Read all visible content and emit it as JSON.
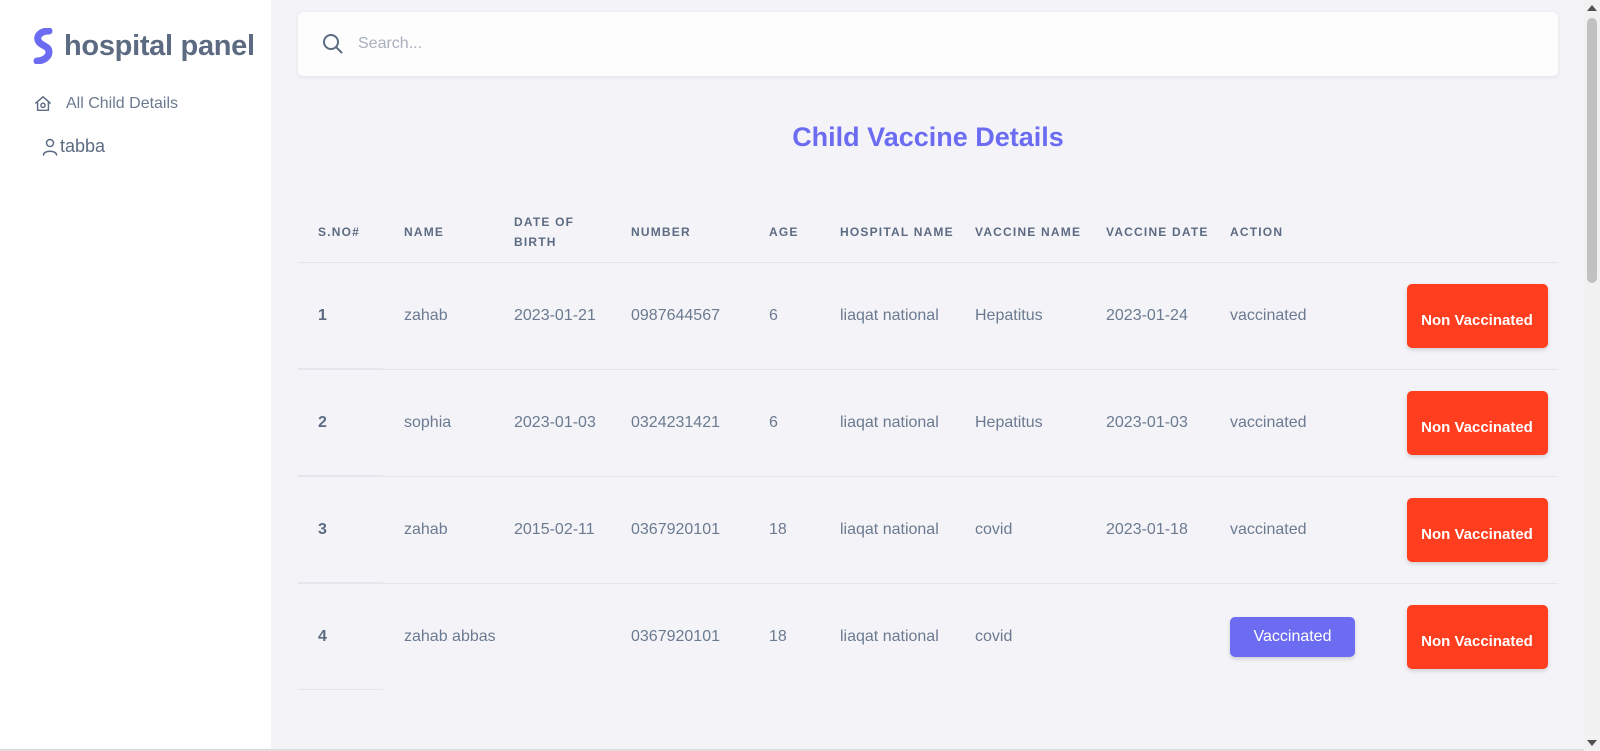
{
  "brand": {
    "name": "hospital panel"
  },
  "sidebar": {
    "items": [
      {
        "label": "All Child Details",
        "icon": "home-icon"
      },
      {
        "label": "tabba",
        "icon": "user-icon"
      }
    ]
  },
  "search": {
    "placeholder": "Search...",
    "value": ""
  },
  "page": {
    "title": "Child Vaccine Details"
  },
  "table": {
    "headers": [
      "S.NO#",
      "NAME",
      "DATE OF BIRTH",
      "NUMBER",
      "AGE",
      "HOSPITAL NAME",
      "VACCINE NAME",
      "VACCINE DATE",
      "ACTION",
      ""
    ],
    "rows": [
      {
        "sno": "1",
        "name": "zahab",
        "dob": "2023-01-21",
        "number": "0987644567",
        "age": "6",
        "hospital": "liaqat national",
        "vaccine": "Hepatitus",
        "vdate": "2023-01-24",
        "action": "vaccinated",
        "action_is_button": false,
        "non_label": "Non Vaccinated"
      },
      {
        "sno": "2",
        "name": "sophia",
        "dob": "2023-01-03",
        "number": "0324231421",
        "age": "6",
        "hospital": "liaqat national",
        "vaccine": "Hepatitus",
        "vdate": "2023-01-03",
        "action": "vaccinated",
        "action_is_button": false,
        "non_label": "Non Vaccinated"
      },
      {
        "sno": "3",
        "name": "zahab",
        "dob": "2015-02-11",
        "number": "0367920101",
        "age": "18",
        "hospital": "liaqat national",
        "vaccine": "covid",
        "vdate": "2023-01-18",
        "action": "vaccinated",
        "action_is_button": false,
        "non_label": "Non Vaccinated"
      },
      {
        "sno": "4",
        "name": "zahab abbas",
        "dob": "",
        "number": "0367920101",
        "age": "18",
        "hospital": "liaqat national",
        "vaccine": "covid",
        "vdate": "",
        "action": "Vaccinated",
        "action_is_button": true,
        "non_label": "Non Vaccinated"
      }
    ]
  },
  "colors": {
    "accent": "#6c6cf2",
    "danger": "#ff3d1f",
    "text": "#6b7a90",
    "background": "#f4f4f8"
  }
}
